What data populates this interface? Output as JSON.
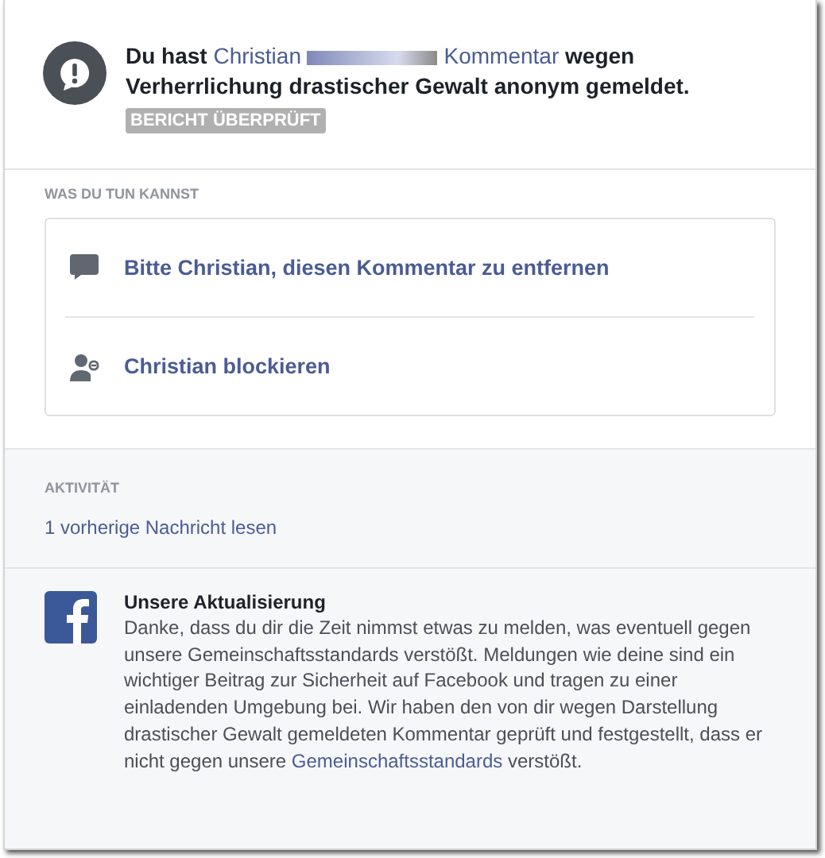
{
  "report": {
    "headline": [
      {
        "kind": "text",
        "text": "Du hast "
      },
      {
        "kind": "link",
        "text": "Christian"
      },
      {
        "kind": "redacted"
      },
      {
        "kind": "link",
        "text": "Kommentar"
      },
      {
        "kind": "text",
        "text": " wegen Verherrlichung drastischer Gewalt anonym gemeldet."
      }
    ],
    "badge": "BERICHT ÜBERPRÜFT"
  },
  "actions": {
    "heading": "WAS DU TUN KANNST",
    "items": [
      {
        "kind": "comment",
        "label": "Bitte Christian, diesen Kommentar zu entfernen"
      },
      {
        "kind": "block",
        "label": "Christian blockieren"
      }
    ]
  },
  "activity": {
    "heading": "AKTIVITÄT",
    "link": "1 vorherige Nachricht lesen",
    "update": {
      "title": "Unsere Aktualisierung",
      "body": [
        {
          "kind": "text",
          "text": "Danke, dass du dir die Zeit nimmst etwas zu melden, was eventuell gegen unsere Gemeinschaftsstandards verstößt. Meldungen wie deine sind ein wichtiger Beitrag zur Sicherheit auf Facebook und tragen zu einer einladenden Umgebung bei. Wir haben den von dir wegen Darstellung drastischer Gewalt gemeldeten Kommentar geprüft und festgestellt, dass er nicht gegen unsere "
        },
        {
          "kind": "link",
          "text": "Gemeinschaftsstandards"
        },
        {
          "kind": "text",
          "text": " verstößt."
        }
      ]
    }
  }
}
